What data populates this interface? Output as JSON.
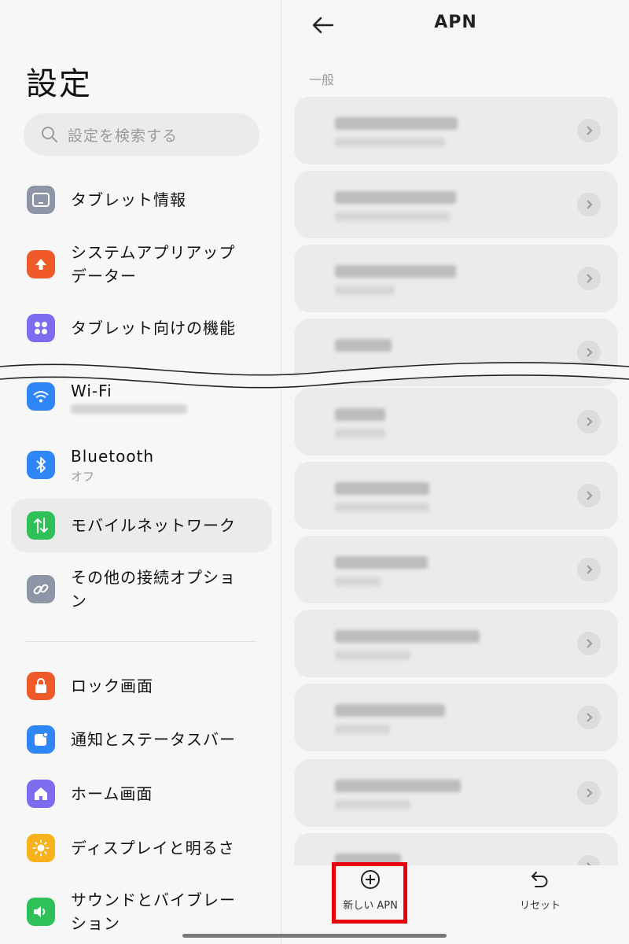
{
  "left": {
    "title": "設定",
    "search_placeholder": "設定を検索する",
    "items": [
      {
        "label": "タブレット情報",
        "icon": "tablet-icon",
        "color": "#8e95a6"
      },
      {
        "label": "システムアプリアップ",
        "label2": "データー",
        "icon": "update-arrow-icon",
        "color": "#f05a28"
      },
      {
        "label": "タブレット向けの機能",
        "icon": "grid-icon",
        "color": "#7b6cf0"
      },
      {
        "label": "Wi-Fi",
        "icon": "wifi-icon",
        "color": "#2f86f6"
      },
      {
        "label": "Bluetooth",
        "sub": "オフ",
        "icon": "bluetooth-icon",
        "color": "#2f86f6"
      },
      {
        "label": "モバイルネットワーク",
        "icon": "mobile-data-icon",
        "color": "#2fc058"
      },
      {
        "label": "その他の接続オプショ",
        "label2": "ン",
        "icon": "link-icon",
        "color": "#8e95a6"
      },
      {
        "label": "ロック画面",
        "icon": "lock-icon",
        "color": "#f05a28"
      },
      {
        "label": "通知とステータスバー",
        "icon": "notification-icon",
        "color": "#2f86f6"
      },
      {
        "label": "ホーム画面",
        "icon": "home-icon",
        "color": "#7b6cf0"
      },
      {
        "label": "ディスプレイと明るさ",
        "icon": "sun-icon",
        "color": "#f7b21c"
      },
      {
        "label": "サウンドとバイブレー",
        "label2": "ション",
        "icon": "speaker-icon",
        "color": "#2fc058"
      }
    ]
  },
  "right": {
    "title": "APN",
    "section": "一般",
    "new_apn_label": "新しい APN",
    "reset_label": "リセット"
  }
}
